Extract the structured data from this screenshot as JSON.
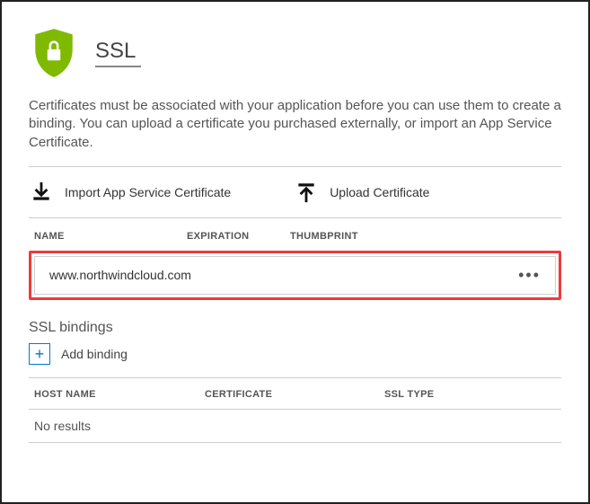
{
  "header": {
    "title": "SSL",
    "description": "Certificates must be associated with your application before you can use them to create a binding. You can upload a certificate you purchased externally, or import an App Service Certificate."
  },
  "actions": {
    "import_label": "Import App Service Certificate",
    "upload_label": "Upload Certificate"
  },
  "cert_table": {
    "columns": {
      "name": "NAME",
      "expiration": "EXPIRATION",
      "thumbprint": "THUMBPRINT"
    },
    "rows": [
      {
        "name": "www.northwindcloud.com"
      }
    ]
  },
  "bindings": {
    "section_title": "SSL bindings",
    "add_label": "Add binding",
    "columns": {
      "host": "HOST NAME",
      "cert": "CERTIFICATE",
      "type": "SSL TYPE"
    },
    "empty_text": "No results"
  },
  "colors": {
    "accent_green": "#7FBA00",
    "accent_blue": "#0078D4",
    "highlight_red": "#EE3B3B"
  }
}
